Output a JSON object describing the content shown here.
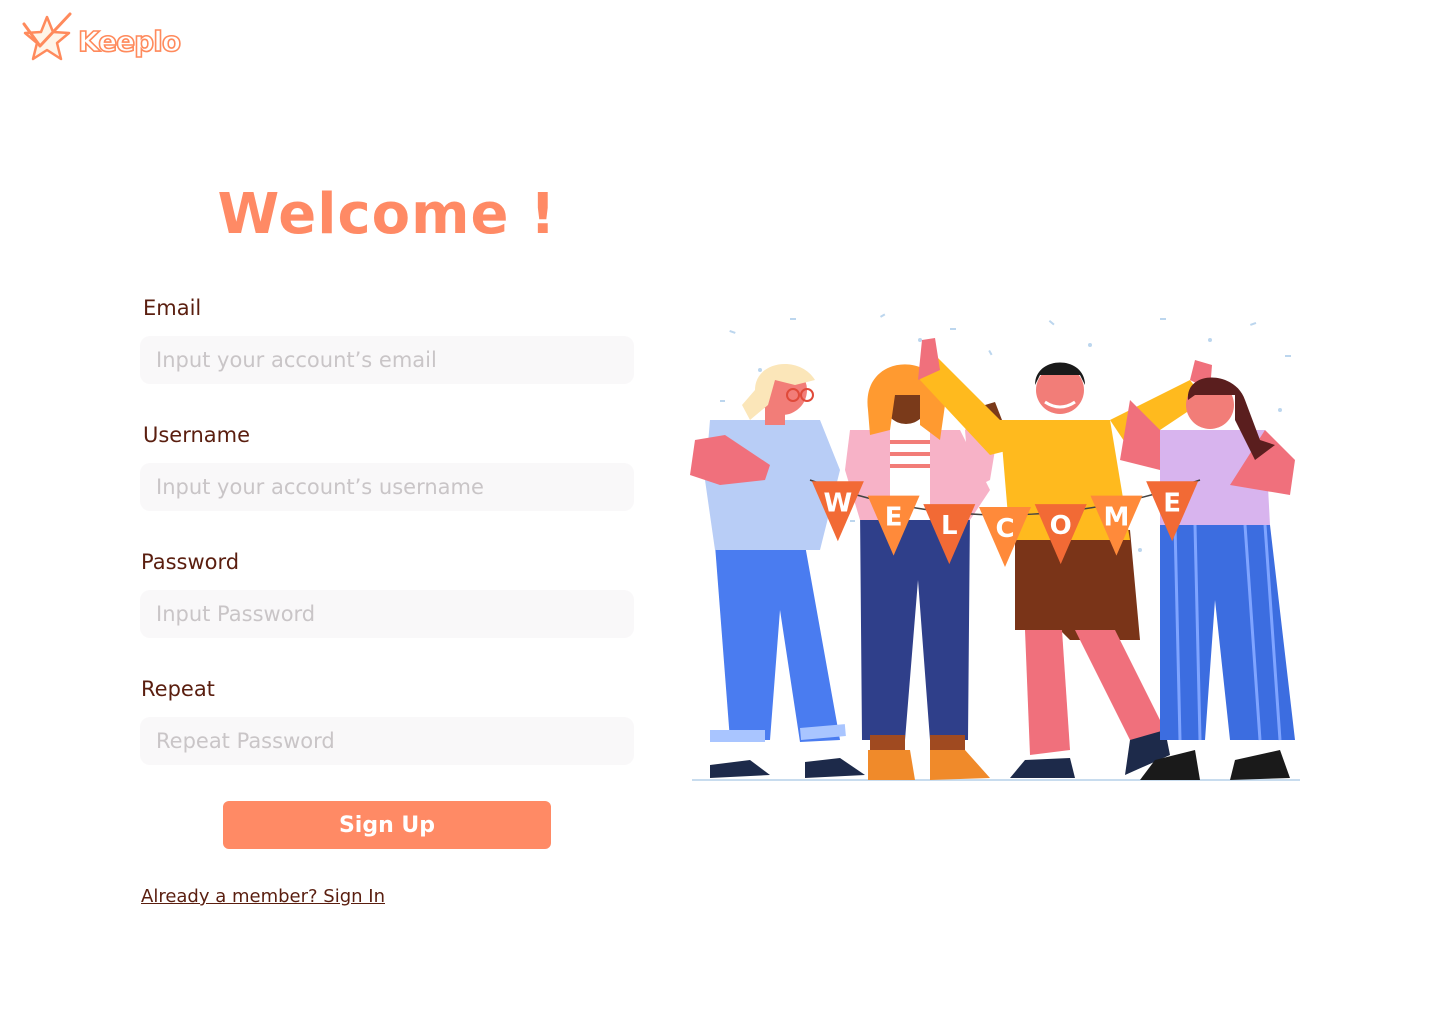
{
  "brand": {
    "name": "Keeplo",
    "accent_color": "#ff8a65",
    "text_color": "#5a1e0f"
  },
  "page": {
    "title": "Welcome !"
  },
  "form": {
    "email": {
      "label": "Email",
      "placeholder": "Input your account’s email",
      "value": ""
    },
    "username": {
      "label": "Username",
      "placeholder": "Input your account’s username",
      "value": ""
    },
    "password": {
      "label": "Password",
      "placeholder": "Input Password",
      "value": ""
    },
    "repeat": {
      "label": "Repeat",
      "placeholder": "Repeat Password",
      "value": ""
    },
    "submit_label": "Sign Up",
    "signin_link": "Already a member? Sign In"
  },
  "illustration": {
    "banner_letters": [
      "W",
      "E",
      "L",
      "C",
      "O",
      "M",
      "E"
    ],
    "icon": "welcome-people-illustration"
  }
}
